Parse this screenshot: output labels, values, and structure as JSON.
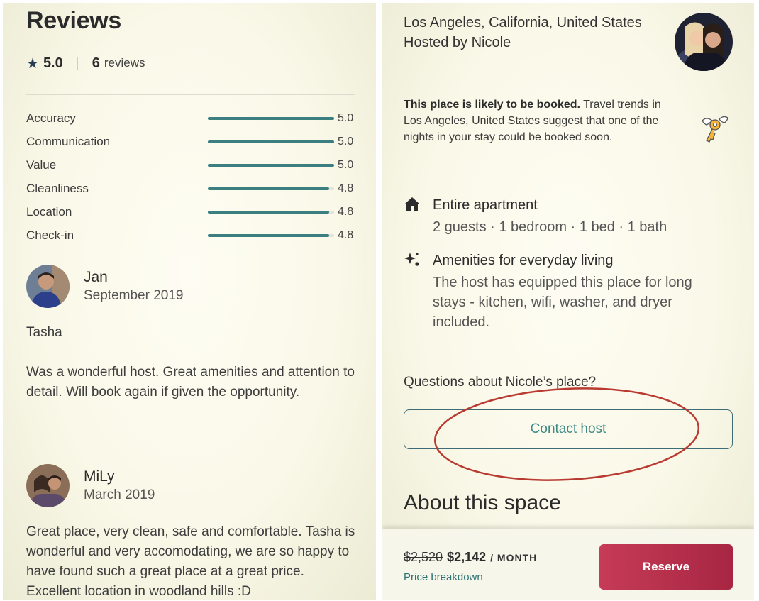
{
  "reviews": {
    "title": "Reviews",
    "overall_rating": "5.0",
    "review_count": "6",
    "review_count_label": "reviews",
    "scores": [
      {
        "label": "Accuracy",
        "value": "5.0",
        "fraction": 1.0
      },
      {
        "label": "Communication",
        "value": "5.0",
        "fraction": 1.0
      },
      {
        "label": "Value",
        "value": "5.0",
        "fraction": 1.0
      },
      {
        "label": "Cleanliness",
        "value": "4.8",
        "fraction": 0.96
      },
      {
        "label": "Location",
        "value": "4.8",
        "fraction": 0.96
      },
      {
        "label": "Check-in",
        "value": "4.8",
        "fraction": 0.96
      }
    ],
    "items": [
      {
        "name": "Jan",
        "date": "September 2019",
        "paragraphs": [
          "Tasha",
          "Was a wonderful host. Great amenities and attention to detail. Will book again if given the opportunity."
        ]
      },
      {
        "name": "MiLy",
        "date": "March 2019",
        "paragraphs": [
          "Great place, very clean, safe and comfortable. Tasha is wonderful and very accomodating, we are so happy to have found such a great place at a great price. Excellent location in woodland hills :D"
        ]
      }
    ]
  },
  "listing": {
    "location": "Los Angeles, California, United States",
    "hosted_by": "Hosted by Nicole",
    "booking_notice_bold": "This place is likely to be booked.",
    "booking_notice_text": " Travel trends in Los Angeles, United States suggest that one of the nights in your stay could be booked soon.",
    "features": [
      {
        "icon": "home-icon",
        "title": "Entire apartment",
        "desc": "2 guests · 1 bedroom · 1 bed · 1 bath"
      },
      {
        "icon": "sparkle-icon",
        "title": "Amenities for everyday living",
        "desc": "The host has equipped this place for long stays - kitchen, wifi, washer, and dryer included."
      }
    ],
    "questions_label": "Questions about Nicole’s place?",
    "contact_button": "Contact host",
    "about_title": "About this space"
  },
  "booking_bar": {
    "old_price": "$2,520",
    "new_price": "$2,142",
    "per_label": "/ MONTH",
    "price_breakdown": "Price breakdown",
    "reserve_button": "Reserve"
  },
  "colors": {
    "score_bar": "#3b7f80",
    "accent_teal": "#3b8a86",
    "reserve": "#b8304d",
    "annotation": "#b93a30"
  }
}
